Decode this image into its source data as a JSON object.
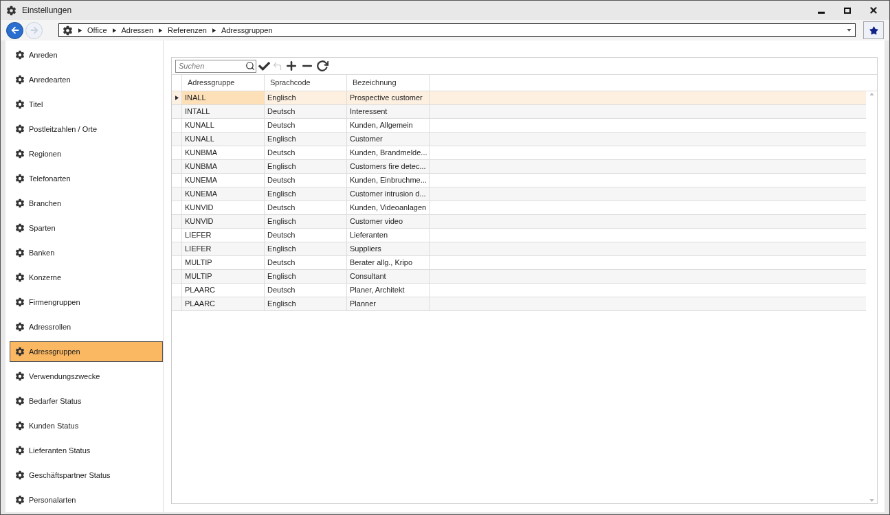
{
  "window": {
    "title": "Einstellungen"
  },
  "breadcrumb": [
    "Office",
    "Adressen",
    "Referenzen",
    "Adressgruppen"
  ],
  "sidebar": {
    "items": [
      {
        "label": "Anreden",
        "selected": false
      },
      {
        "label": "Anredearten",
        "selected": false
      },
      {
        "label": "Titel",
        "selected": false
      },
      {
        "label": "Postleitzahlen / Orte",
        "selected": false
      },
      {
        "label": "Regionen",
        "selected": false
      },
      {
        "label": "Telefonarten",
        "selected": false
      },
      {
        "label": "Branchen",
        "selected": false
      },
      {
        "label": "Sparten",
        "selected": false
      },
      {
        "label": "Banken",
        "selected": false
      },
      {
        "label": "Konzerne",
        "selected": false
      },
      {
        "label": "Firmengruppen",
        "selected": false
      },
      {
        "label": "Adressrollen",
        "selected": false
      },
      {
        "label": "Adressgruppen",
        "selected": true
      },
      {
        "label": "Verwendungszwecke",
        "selected": false
      },
      {
        "label": "Bedarfer Status",
        "selected": false
      },
      {
        "label": "Kunden Status",
        "selected": false
      },
      {
        "label": "Lieferanten Status",
        "selected": false
      },
      {
        "label": "Geschäftspartner Status",
        "selected": false
      },
      {
        "label": "Personalarten",
        "selected": false
      }
    ]
  },
  "search": {
    "placeholder": "Suchen"
  },
  "table": {
    "columns": [
      "Adressgruppe",
      "Sprachcode",
      "Bezeichnung"
    ],
    "rows": [
      {
        "cells": [
          "INALL",
          "Englisch",
          "Prospective customer"
        ],
        "selected": true
      },
      {
        "cells": [
          "INTALL",
          "Deutsch",
          "Interessent"
        ],
        "selected": false
      },
      {
        "cells": [
          "KUNALL",
          "Deutsch",
          "Kunden, Allgemein"
        ],
        "selected": false
      },
      {
        "cells": [
          "KUNALL",
          "Englisch",
          "Customer"
        ],
        "selected": false
      },
      {
        "cells": [
          "KUNBMA",
          "Deutsch",
          "Kunden, Brandmelde..."
        ],
        "selected": false
      },
      {
        "cells": [
          "KUNBMA",
          "Englisch",
          "Customers fire detec..."
        ],
        "selected": false
      },
      {
        "cells": [
          "KUNEMA",
          "Deutsch",
          "Kunden, Einbruchme..."
        ],
        "selected": false
      },
      {
        "cells": [
          "KUNEMA",
          "Englisch",
          "Customer intrusion d..."
        ],
        "selected": false
      },
      {
        "cells": [
          "KUNVID",
          "Deutsch",
          "Kunden, Videoanlagen"
        ],
        "selected": false
      },
      {
        "cells": [
          "KUNVID",
          "Englisch",
          "Customer video"
        ],
        "selected": false
      },
      {
        "cells": [
          "LIEFER",
          "Deutsch",
          "Lieferanten"
        ],
        "selected": false
      },
      {
        "cells": [
          "LIEFER",
          "Englisch",
          "Suppliers"
        ],
        "selected": false
      },
      {
        "cells": [
          "MULTIP",
          "Deutsch",
          "Berater allg., Kripo"
        ],
        "selected": false
      },
      {
        "cells": [
          "MULTIP",
          "Englisch",
          "Consultant"
        ],
        "selected": false
      },
      {
        "cells": [
          "PLAARC",
          "Deutsch",
          "Planer, Architekt"
        ],
        "selected": false
      },
      {
        "cells": [
          "PLAARC",
          "Englisch",
          "Planner"
        ],
        "selected": false
      }
    ]
  }
}
